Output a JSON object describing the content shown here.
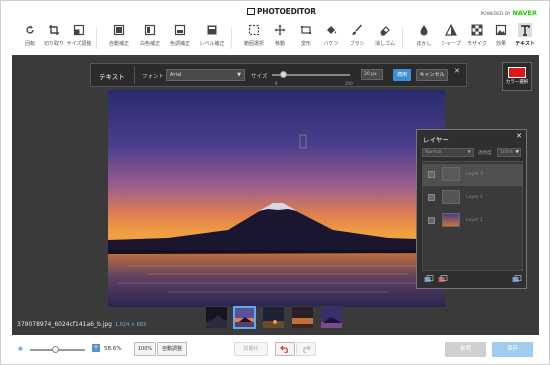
{
  "header": {
    "logo": "PHOTOEDITOR",
    "powered_by": "POWERED BY",
    "brand": "NAVER"
  },
  "toolbar": [
    {
      "label": "回転",
      "icon": "rotate-icon"
    },
    {
      "label": "切り取り",
      "icon": "crop-icon"
    },
    {
      "label": "サイズ調整",
      "icon": "resize-icon"
    },
    {
      "label": "自動補正",
      "icon": "auto-correct-icon"
    },
    {
      "label": "白色補正",
      "icon": "white-balance-icon"
    },
    {
      "label": "色調補正",
      "icon": "color-tone-icon"
    },
    {
      "label": "レベル補正",
      "icon": "level-icon"
    },
    {
      "label": "範囲選択",
      "icon": "selection-icon"
    },
    {
      "label": "移動",
      "icon": "move-icon"
    },
    {
      "label": "変形",
      "icon": "transform-icon"
    },
    {
      "label": "バケツ",
      "icon": "bucket-icon"
    },
    {
      "label": "ブラシ",
      "icon": "brush-icon"
    },
    {
      "label": "消しゴム",
      "icon": "eraser-icon"
    },
    {
      "label": "ぼかし",
      "icon": "blur-icon"
    },
    {
      "label": "シャープ",
      "icon": "sharpen-icon"
    },
    {
      "label": "モザイク",
      "icon": "mosaic-icon"
    },
    {
      "label": "効果",
      "icon": "effect-icon"
    },
    {
      "label": "テキスト",
      "icon": "text-icon"
    }
  ],
  "text_panel": {
    "title": "テキスト",
    "font_label": "フォント",
    "font_value": "Arial",
    "size_label": "サイズ",
    "size_min": "8",
    "size_max": "200",
    "size_value": "20 px",
    "apply": "適用",
    "cancel": "キャンセル"
  },
  "color_select": {
    "label": "カラー選択",
    "color": "#e3141b"
  },
  "layers": {
    "title": "レイヤー",
    "blend": "Normal",
    "opacity_label": "透明度",
    "opacity_value": "100%",
    "items": [
      {
        "name": "Layer 3"
      },
      {
        "name": "Layer 2"
      },
      {
        "name": "Layer 1"
      }
    ]
  },
  "file": {
    "name": "379078974_6024cf141a6_b.jpg",
    "dims": "1,024 × 683"
  },
  "bottom": {
    "zoom_value": "58.6%",
    "btn_100": "100%",
    "btn_auto": "自動調整",
    "btn_init": "初期化",
    "btn_open": "参照",
    "btn_save": "保存"
  },
  "colors": {
    "accent": "#3d8fd6",
    "workspace": "#3a3a3a",
    "brand": "#1ec800"
  }
}
